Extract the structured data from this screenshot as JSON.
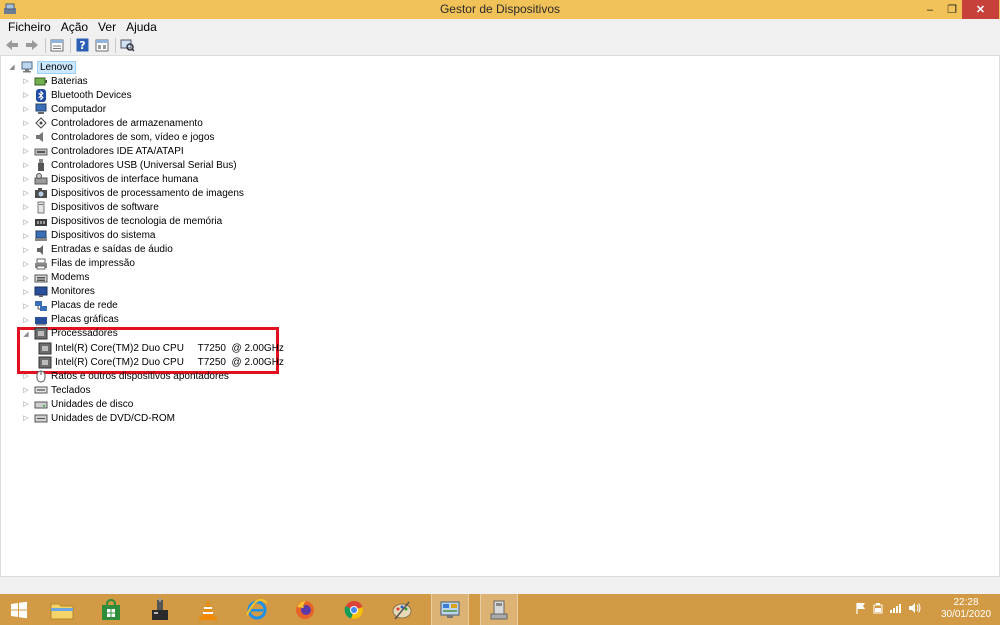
{
  "window": {
    "title": "Gestor de Dispositivos",
    "min_label": "–",
    "max_label": "❐",
    "close_label": "✕"
  },
  "menu": [
    "Ficheiro",
    "Ação",
    "Ver",
    "Ajuda"
  ],
  "tree": {
    "root": "Lenovo",
    "categories": [
      {
        "label": "Baterias",
        "icon": "battery-icon"
      },
      {
        "label": "Bluetooth Devices",
        "icon": "bluetooth-icon"
      },
      {
        "label": "Computador",
        "icon": "computer-icon"
      },
      {
        "label": "Controladores de armazenamento",
        "icon": "storage-controller-icon"
      },
      {
        "label": "Controladores de som, vídeo e jogos",
        "icon": "speaker-icon"
      },
      {
        "label": "Controladores IDE ATA/ATAPI",
        "icon": "ide-controller-icon"
      },
      {
        "label": "Controladores USB (Universal Serial Bus)",
        "icon": "usb-icon"
      },
      {
        "label": "Dispositivos de interface humana",
        "icon": "hid-icon"
      },
      {
        "label": "Dispositivos de processamento de imagens",
        "icon": "camera-icon"
      },
      {
        "label": "Dispositivos de software",
        "icon": "software-device-icon"
      },
      {
        "label": "Dispositivos de tecnologia de memória",
        "icon": "memory-icon"
      },
      {
        "label": "Dispositivos do sistema",
        "icon": "system-device-icon"
      },
      {
        "label": "Entradas e saídas de áudio",
        "icon": "audio-io-icon"
      },
      {
        "label": "Filas de impressão",
        "icon": "printer-icon"
      },
      {
        "label": "Modems",
        "icon": "modem-icon"
      },
      {
        "label": "Monitores",
        "icon": "monitor-icon"
      },
      {
        "label": "Placas de rede",
        "icon": "network-adapter-icon"
      },
      {
        "label": "Placas gráficas",
        "icon": "display-adapter-icon"
      },
      {
        "label": "Processadores",
        "icon": "processor-icon",
        "expanded": true,
        "children": [
          "Intel(R) Core(TM)2 Duo CPU     T7250  @ 2.00GHz",
          "Intel(R) Core(TM)2 Duo CPU     T7250  @ 2.00GHz"
        ]
      },
      {
        "label": "Ratos e outros dispositivos apontadores",
        "icon": "mouse-icon"
      },
      {
        "label": "Teclados",
        "icon": "keyboard-icon"
      },
      {
        "label": "Unidades de disco",
        "icon": "disk-drive-icon"
      },
      {
        "label": "Unidades de DVD/CD-ROM",
        "icon": "dvd-drive-icon"
      }
    ]
  },
  "taskbar": {
    "apps": [
      "start",
      "file-explorer",
      "store",
      "tool-app",
      "vlc",
      "internet-explorer",
      "firefox",
      "chrome",
      "paint",
      "control-panel",
      "device-manager"
    ],
    "clock_time": "22:28",
    "clock_date": "30/01/2020"
  },
  "colors": {
    "titlebar": "#f1c257",
    "taskbar": "#d29a45",
    "close": "#c7403a",
    "highlight": "#e1111f"
  }
}
